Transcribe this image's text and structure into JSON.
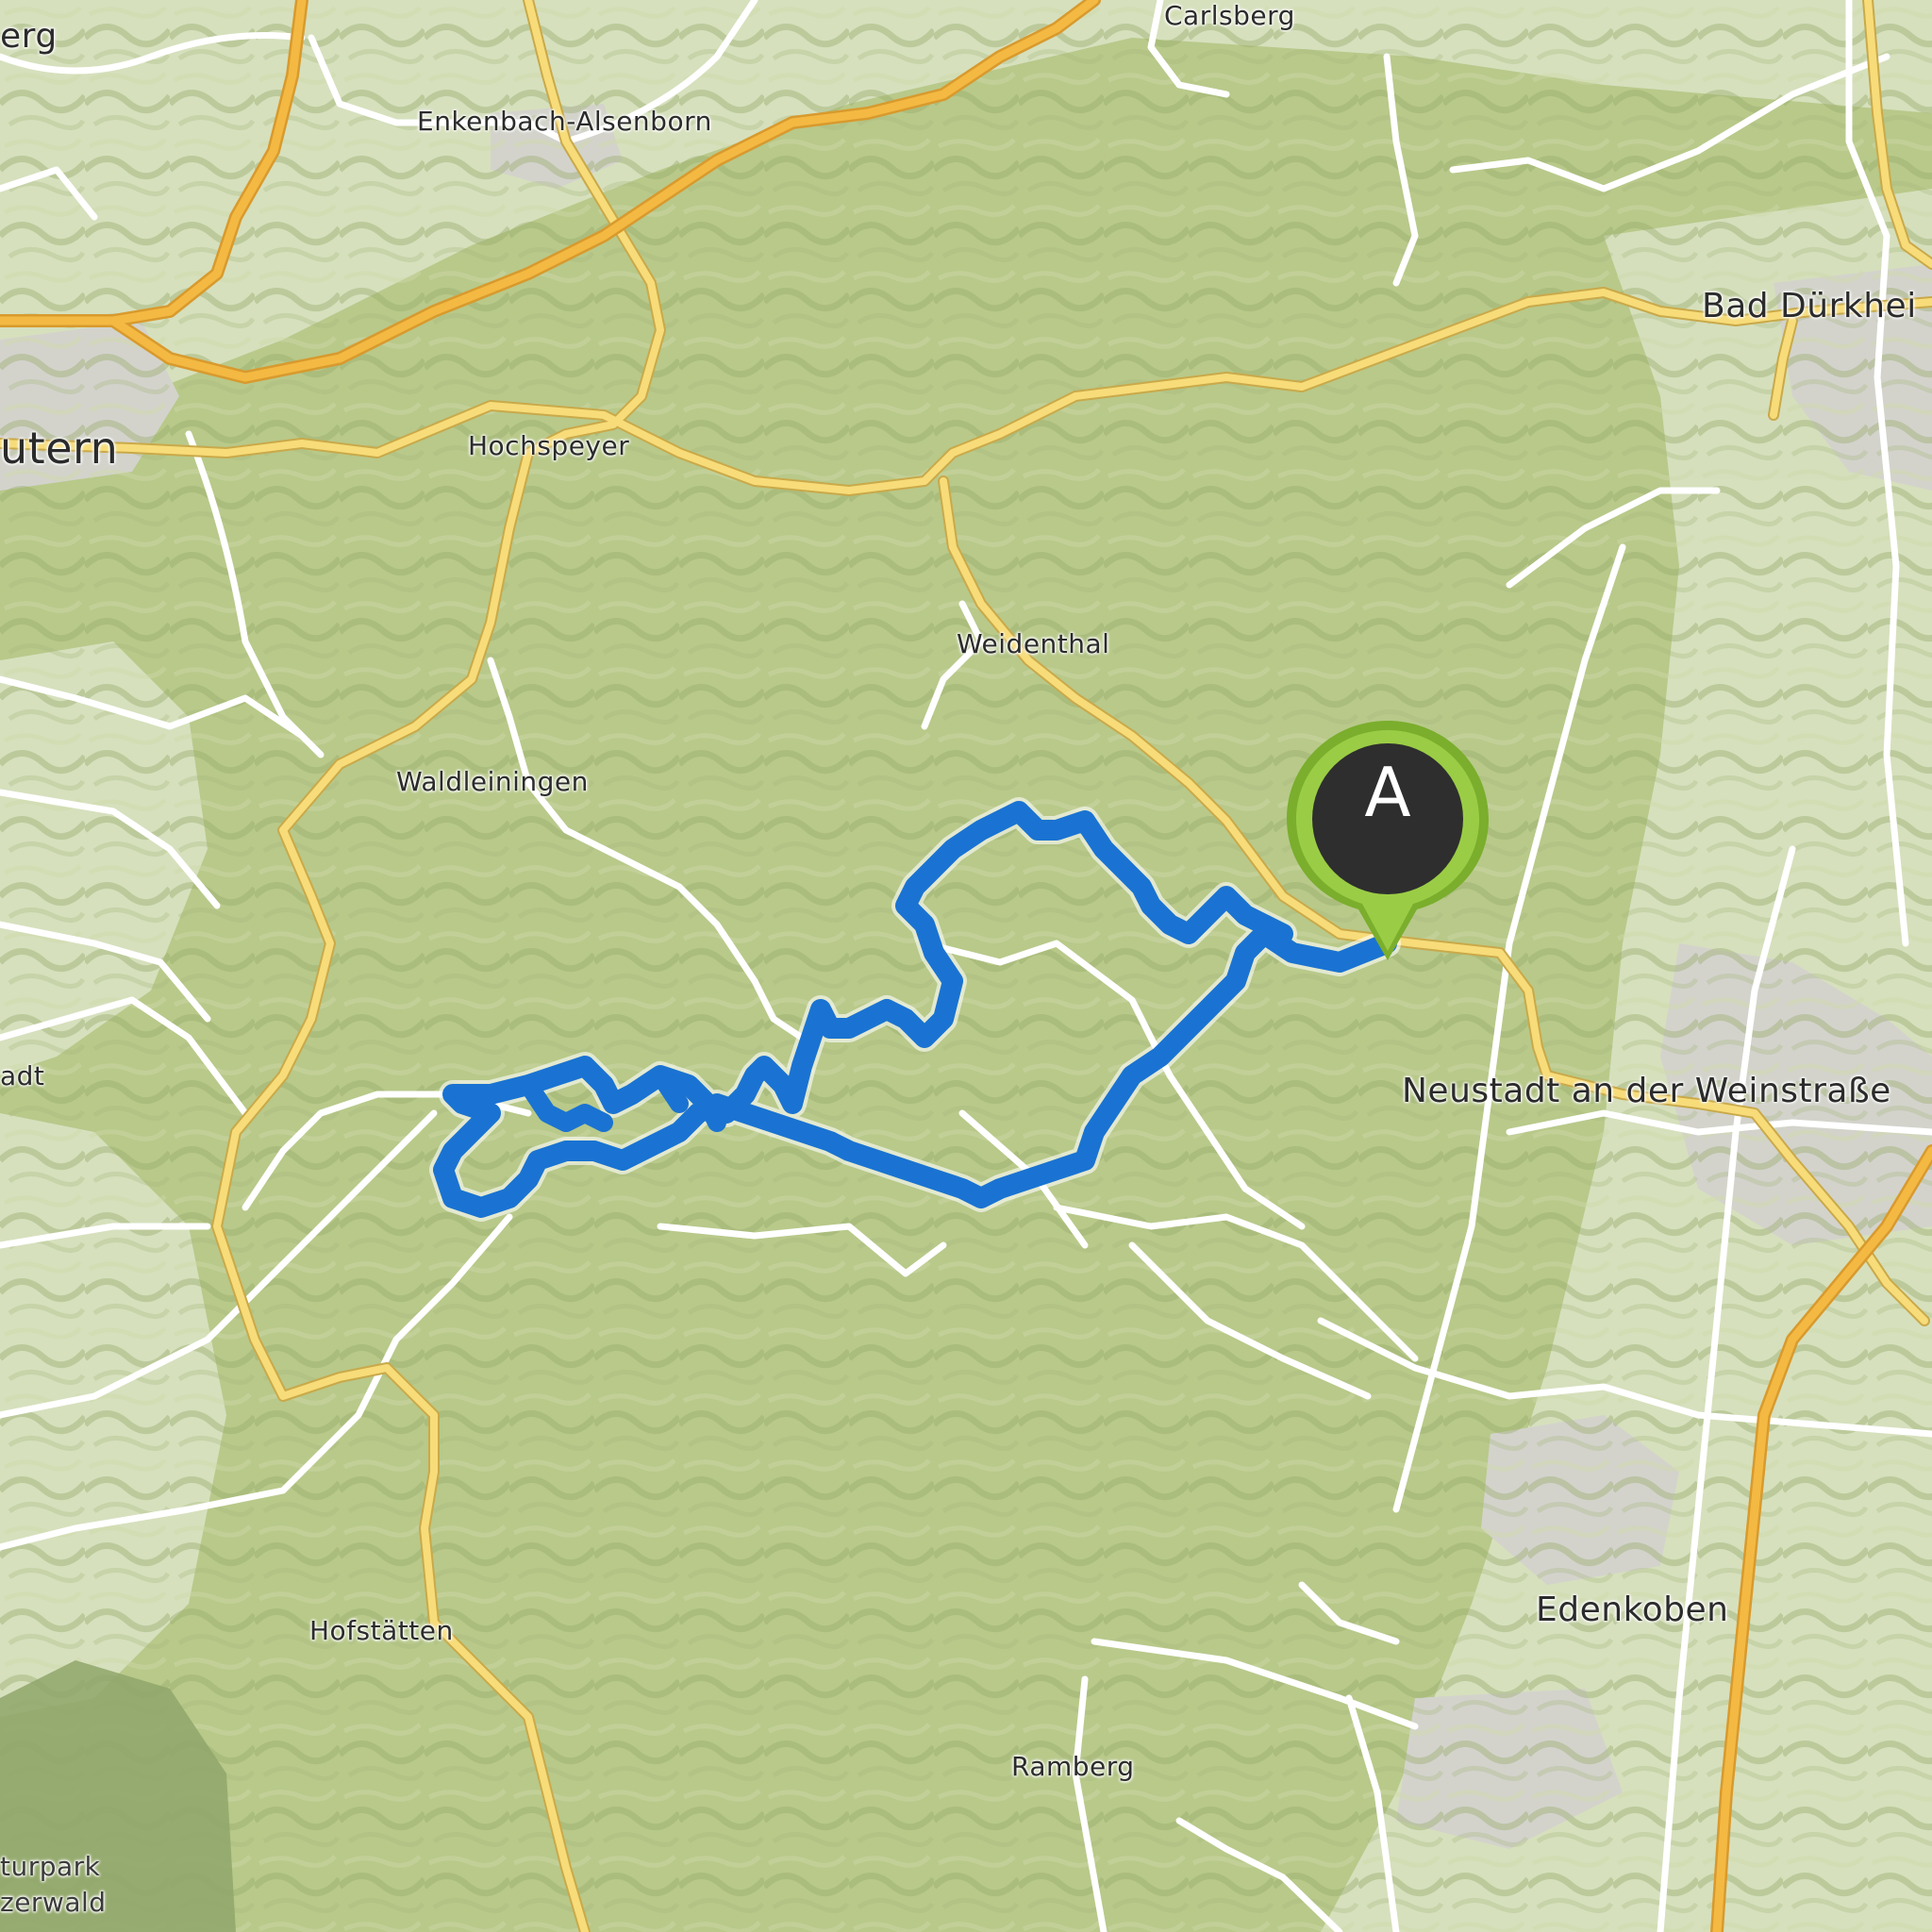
{
  "map": {
    "places": [
      {
        "id": "carlsberg",
        "name": "Carlsberg"
      },
      {
        "id": "erg",
        "name": "erg"
      },
      {
        "id": "enkenbach",
        "name": "Enkenbach-Alsenborn"
      },
      {
        "id": "bad-durkheim",
        "name": "Bad Dürkhei"
      },
      {
        "id": "lautern",
        "name": "utern"
      },
      {
        "id": "hochspeyer",
        "name": "Hochspeyer"
      },
      {
        "id": "weidenthal",
        "name": "Weidenthal"
      },
      {
        "id": "waldleiningen",
        "name": "Waldleiningen"
      },
      {
        "id": "neustadt",
        "name": "Neustadt an der Weinstraße"
      },
      {
        "id": "adt",
        "name": "adt"
      },
      {
        "id": "edenkoben",
        "name": "Edenkoben"
      },
      {
        "id": "hofstatten",
        "name": "Hofstätten"
      },
      {
        "id": "ramberg",
        "name": "Ramberg"
      },
      {
        "id": "naturpark-1",
        "name": "turpark"
      },
      {
        "id": "naturpark-2",
        "name": "zerwald"
      }
    ],
    "route": {
      "color": "#1a73d2"
    },
    "start_marker": {
      "letter": "A",
      "fill": "#8cc63f",
      "inner": "#2e2e2e"
    },
    "colors": {
      "forest": "#b8c98a",
      "open_land": "#d9e2c2",
      "urban": "#d6d6d0",
      "major_road": "#f4b942",
      "secondary_road": "#f7dc79",
      "minor_road": "#ffffff"
    }
  }
}
